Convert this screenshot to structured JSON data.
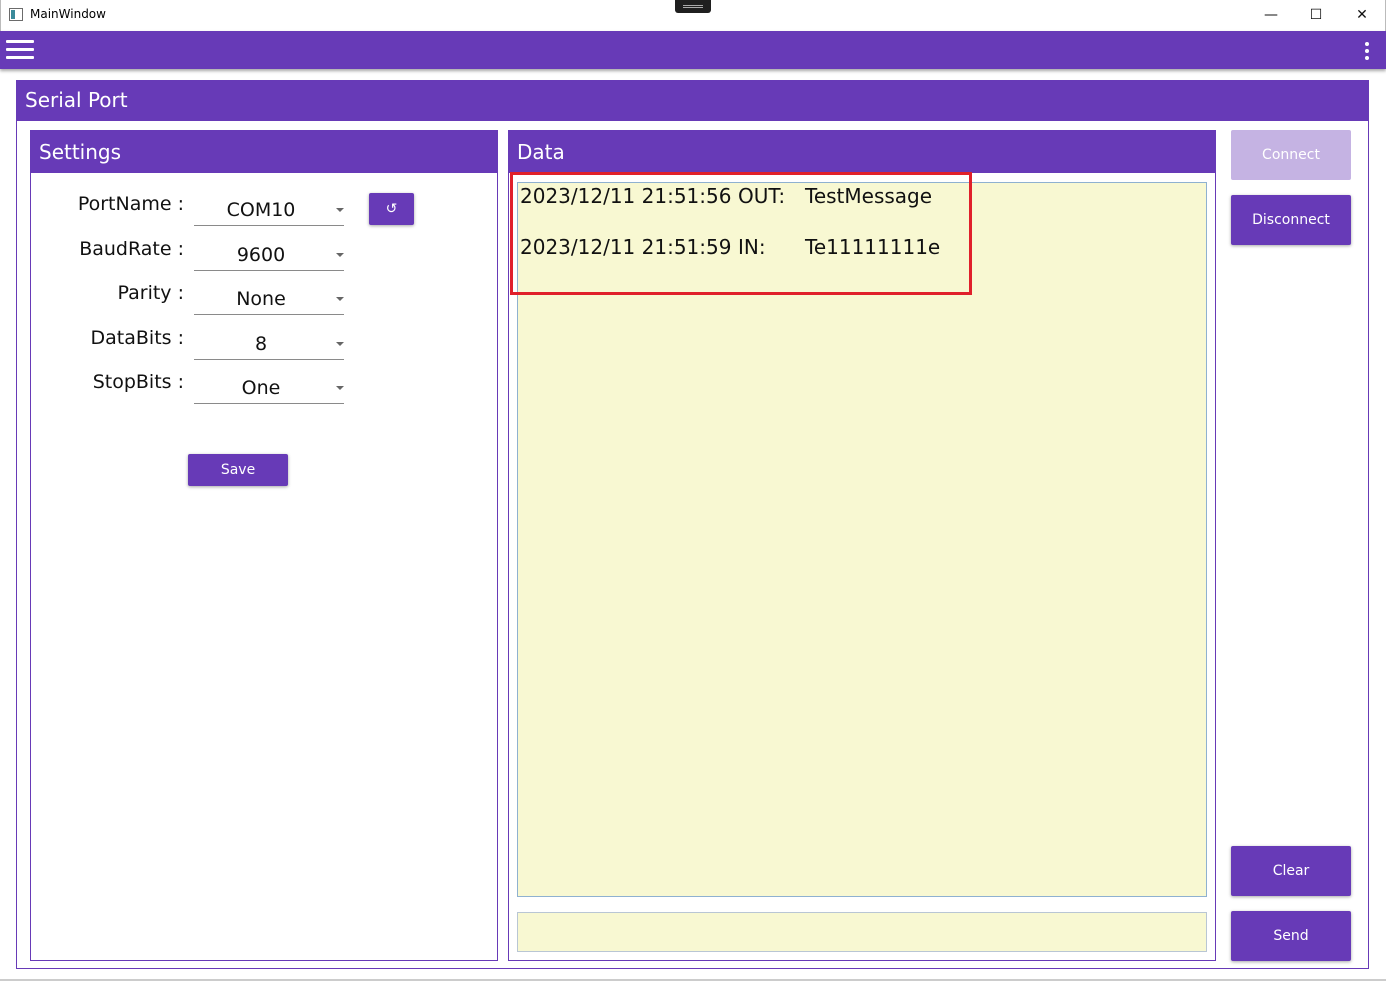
{
  "window": {
    "title": "MainWindow",
    "minimize_glyph": "—",
    "maximize_glyph": "☐",
    "close_glyph": "✕"
  },
  "appbar": {
    "menu_icon": "hamburger-menu-icon",
    "more_icon": "more-vert-icon"
  },
  "serial_port": {
    "header": "Serial Port",
    "settings": {
      "header": "Settings",
      "fields": [
        {
          "label": "PortName :",
          "value": "COM10"
        },
        {
          "label": "BaudRate :",
          "value": "9600"
        },
        {
          "label": "Parity :",
          "value": "None"
        },
        {
          "label": "DataBits :",
          "value": "8"
        },
        {
          "label": "StopBits :",
          "value": "One"
        }
      ],
      "refresh_glyph": "↺",
      "save_label": "Save"
    },
    "data": {
      "header": "Data",
      "log": [
        {
          "timestamp": "2023/12/11 21:51:56",
          "direction": "OUT:",
          "message": "TestMessage"
        },
        {
          "timestamp": "2023/12/11 21:51:59",
          "direction": "IN:",
          "message": "Te11111111e"
        }
      ],
      "send_input_value": ""
    },
    "actions": {
      "connect_label": "Connect",
      "disconnect_label": "Disconnect",
      "clear_label": "Clear",
      "send_label": "Send"
    }
  },
  "colors": {
    "accent": "#673ab7",
    "accent_disabled": "#c5b3e3",
    "log_background": "#f8f8d2",
    "highlight": "#e0202a"
  }
}
